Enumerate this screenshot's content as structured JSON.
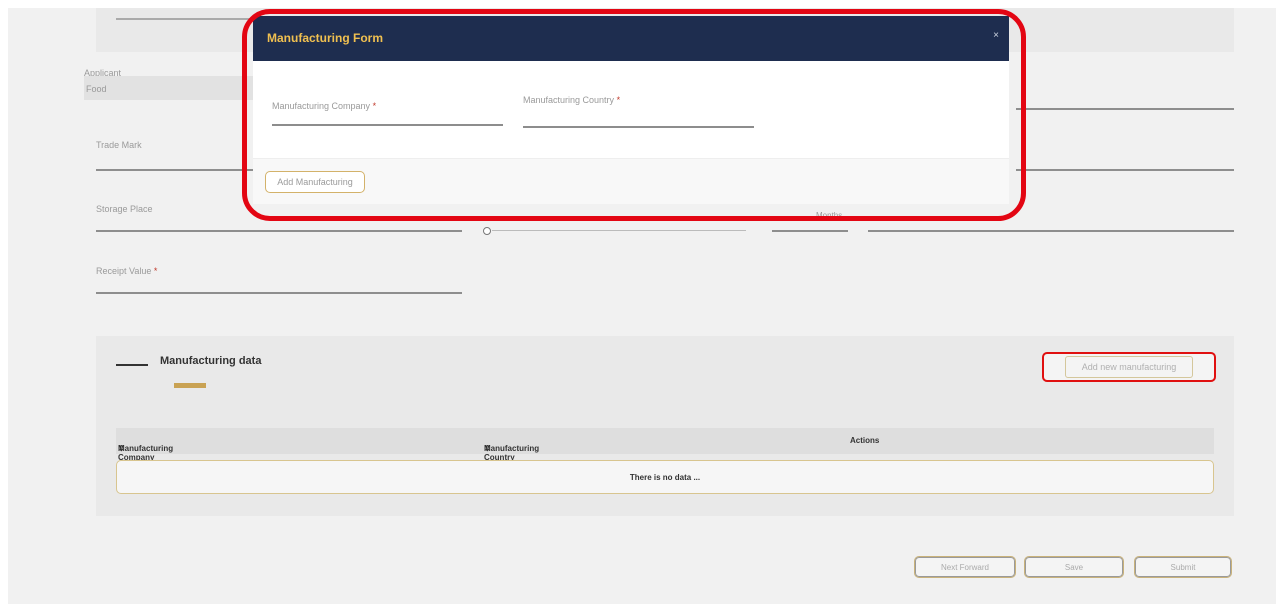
{
  "form": {
    "applicant_label": "Applicant",
    "applicant_value": "Food",
    "trade_mark_label": "Trade Mark",
    "storage_place_label": "Storage Place",
    "period_label": "Months",
    "receipt_value_label": "Receipt Value",
    "required_mark": "*"
  },
  "manufacturing_section": {
    "title": "Manufacturing data",
    "add_button": "Add new manufacturing",
    "columns": [
      "Manufacturing Company",
      "Manufacturing Country",
      "Actions"
    ],
    "sort_glyph": "⇕",
    "empty_text": "There is no data ..."
  },
  "footer": {
    "buttons": [
      "Next Forward",
      "Save",
      "Submit"
    ]
  },
  "modal": {
    "title": "Manufacturing Form",
    "close_glyph": "×",
    "company_label": "Manufacturing Company",
    "country_label": "Manufacturing Country",
    "required_mark": "*",
    "add_button": "Add Manufacturing"
  },
  "colors": {
    "modal_header": "#1e2d4f",
    "modal_title": "#f0c050",
    "highlight": "#e30613",
    "accent": "#c9a253"
  },
  "icons": [
    "close-icon",
    "sort-icon"
  ]
}
